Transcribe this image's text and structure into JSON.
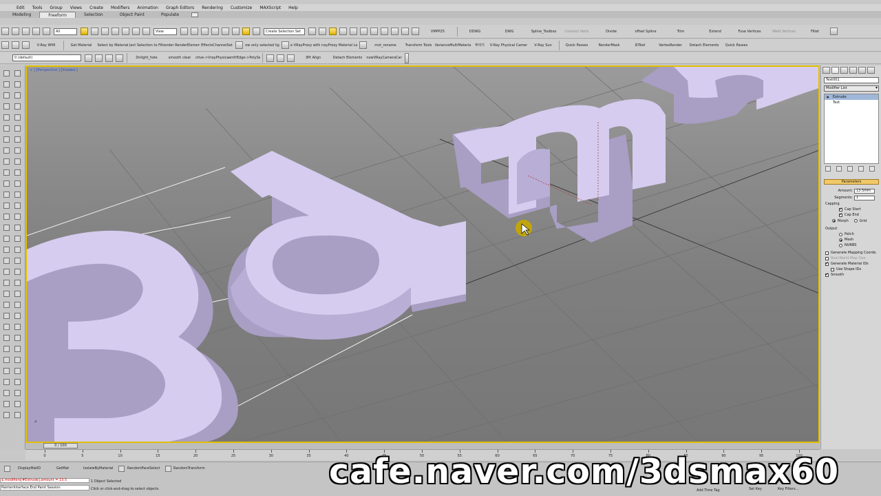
{
  "menu": [
    "Edit",
    "Tools",
    "Group",
    "Views",
    "Create",
    "Modifiers",
    "Animation",
    "Graph Editors",
    "Rendering",
    "Customize",
    "MAXScript",
    "Help"
  ],
  "ribbon_tabs": [
    {
      "label": "Modeling",
      "active": false
    },
    {
      "label": "Freeform",
      "active": true
    },
    {
      "label": "Selection",
      "active": false
    },
    {
      "label": "Object Paint",
      "active": false
    },
    {
      "label": "Populate",
      "active": false
    }
  ],
  "main_toolbar": {
    "filter": "All",
    "ref_coord": "View",
    "selection_set": "Create Selection Set",
    "scripts": [
      "VMPP25",
      "DDWG",
      "DWG",
      "Spline_Toolbox",
      "Connect Verts",
      "Divide",
      "offset Spline",
      "Trim",
      "Extend",
      "Fuse Vertices",
      "Weld Vertices",
      "Fillet"
    ],
    "disabled": [
      "Connect Verts",
      "Weld Vertices"
    ]
  },
  "ext_toolbar_1": {
    "items": [
      "V-Ray Wfill",
      "Get Material",
      "Select by Material",
      "Ject Selection to Filte",
      "ender RenderElemen",
      "EffectsChannelSet",
      "ow only selected lig",
      "e VRayProxy with m",
      "ayProxy Material Lo",
      "mxt_rename",
      "Transform Tools",
      "VarianceMultiMateria",
      "부이기",
      "V-Ray Physical Camer",
      "V-Ray Sun",
      "Quick Passes",
      "RenderMask",
      "IDTool",
      "VertexRender",
      "Detach Elements",
      "Quick Passes"
    ]
  },
  "ext_toolbar_2": {
    "layer": "0 (default)",
    "items": [
      "Dnlight_hole",
      "smooth clear",
      "ctive->VrayPhysical",
      "amfrEdge->PolySek",
      "3Pt Align",
      "Detach Elements",
      "nowVRayCameraCar"
    ]
  },
  "viewport": {
    "label": "+ ] [Perspective ] [Shaded ]",
    "text_object": "3d ma",
    "letter_color": "#d6ccef",
    "letter_side": "#a99ec4",
    "active_border": "#e3c000"
  },
  "command_panel": {
    "object_name": "Text001",
    "modifier_list": "Modifier List",
    "stack": [
      {
        "label": "Extrude",
        "selected": true
      },
      {
        "label": "Text",
        "selected": false
      }
    ],
    "rollout": "Parameters",
    "amount_label": "Amount:",
    "amount_value": "13.5mm",
    "segments_label": "Segments:",
    "segments_value": "1",
    "capping_label": "Capping",
    "cap_start": "Cap Start",
    "cap_end": "Cap End",
    "morph": "Morph",
    "grid": "Grid",
    "output_label": "Output",
    "patch": "Patch",
    "mesh": "Mesh",
    "nurbs": "NURBS",
    "gen_mapping": "Generate Mapping Coords.",
    "real_world": "Real-World Map Size",
    "gen_mat_ids": "Generate Material IDs",
    "use_shape_ids": "Use Shape IDs",
    "smooth": "Smooth"
  },
  "timeline": {
    "slider": "0 / 100",
    "ticks": [
      0,
      5,
      10,
      15,
      20,
      25,
      30,
      35,
      40,
      45,
      50,
      55,
      60,
      65,
      70,
      75,
      80,
      85,
      90,
      95,
      100
    ]
  },
  "bottom_bar": {
    "macros": [
      "DisplayMatID",
      "GetMat",
      "IsolateByMaterial",
      "RandomFaceSelect",
      "RandomTransform"
    ],
    "maxscript_line": "$.modifiers[#Extrude].amount = 13.5",
    "maxscript_listener": "PainterInterface End Paint Session",
    "status_selection": "1 Object Selected",
    "status_prompt": "Click or click-and-drag to select objects",
    "add_time_tag": "Add Time Tag",
    "set_key": "Set Key",
    "key_filters": "Key Filters..."
  },
  "watermark": "cafe.naver.com/3dsmax60"
}
